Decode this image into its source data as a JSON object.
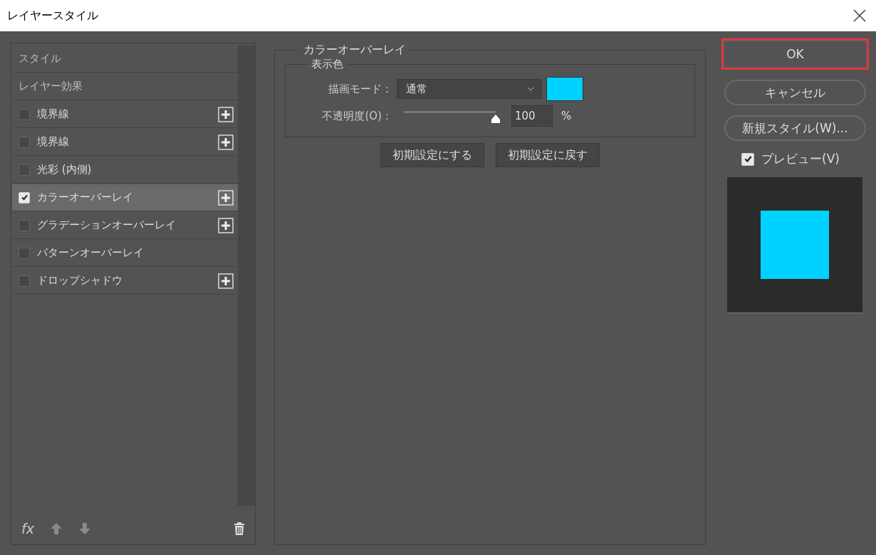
{
  "window": {
    "title": "レイヤースタイル"
  },
  "sidebar": {
    "items": [
      {
        "kind": "header",
        "label": "スタイル",
        "selected": false
      },
      {
        "kind": "header",
        "label": "レイヤー効果",
        "selected": false
      },
      {
        "kind": "effect",
        "label": "境界線",
        "checked": false,
        "selected": false,
        "add_button": true
      },
      {
        "kind": "effect",
        "label": "境界線",
        "checked": false,
        "selected": false,
        "add_button": true
      },
      {
        "kind": "effect",
        "label": "光彩 (内側)",
        "checked": false,
        "selected": false,
        "add_button": false
      },
      {
        "kind": "effect",
        "label": "カラーオーバーレイ",
        "checked": true,
        "selected": true,
        "add_button": true
      },
      {
        "kind": "effect",
        "label": "グラデーションオーバーレイ",
        "checked": false,
        "selected": false,
        "add_button": true
      },
      {
        "kind": "effect",
        "label": "パターンオーバーレイ",
        "checked": false,
        "selected": false,
        "add_button": false
      },
      {
        "kind": "effect",
        "label": "ドロップシャドウ",
        "checked": false,
        "selected": false,
        "add_button": true
      }
    ],
    "toolbar": {
      "fx_label": "fx"
    }
  },
  "panel": {
    "title": "カラーオーバーレイ",
    "group_title": "表示色",
    "blend_label": "描画モード：",
    "blend_value": "通常",
    "color": "#00d2ff",
    "opacity": {
      "label": "不透明度(O)：",
      "level": 1.0,
      "value": "100",
      "unit": "%"
    },
    "buttons": [
      "初期設定にする",
      "初期設定に戻す"
    ]
  },
  "actions": {
    "buttons": [
      {
        "label": "OK",
        "highlighted": true
      },
      {
        "label": "キャンセル",
        "highlighted": false
      },
      {
        "label": "新規スタイル(W)...",
        "highlighted": false
      }
    ],
    "preview": {
      "label": "プレビュー(V)",
      "checked": true
    }
  }
}
